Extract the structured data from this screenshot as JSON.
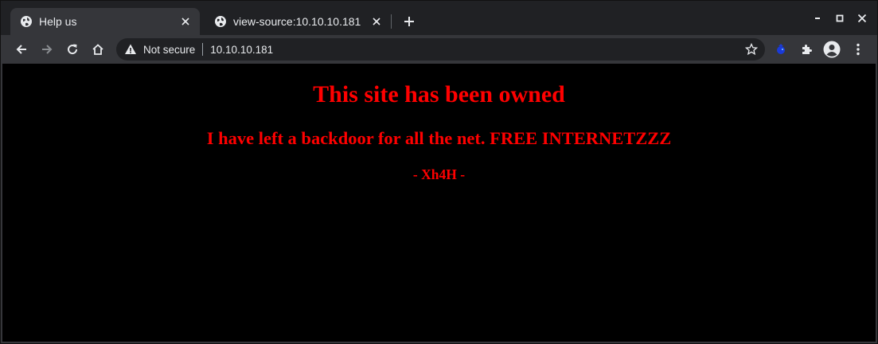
{
  "tabs": [
    {
      "title": "Help us",
      "active": true,
      "icon": "globe-icon"
    },
    {
      "title": "view-source:10.10.10.181",
      "active": false,
      "icon": "globe-icon"
    }
  ],
  "toolbar": {
    "security_label": "Not secure",
    "url": "10.10.10.181"
  },
  "page": {
    "heading": "This site has been owned",
    "message": "I have left a backdoor for all the net. FREE INTERNETZZZ",
    "signature": "- Xh4H -",
    "text_color": "#ff0000",
    "background_color": "#000000"
  },
  "colors": {
    "titlebar": "#202124",
    "toolbar": "#35363a",
    "accent_text": "#e8eaed"
  }
}
